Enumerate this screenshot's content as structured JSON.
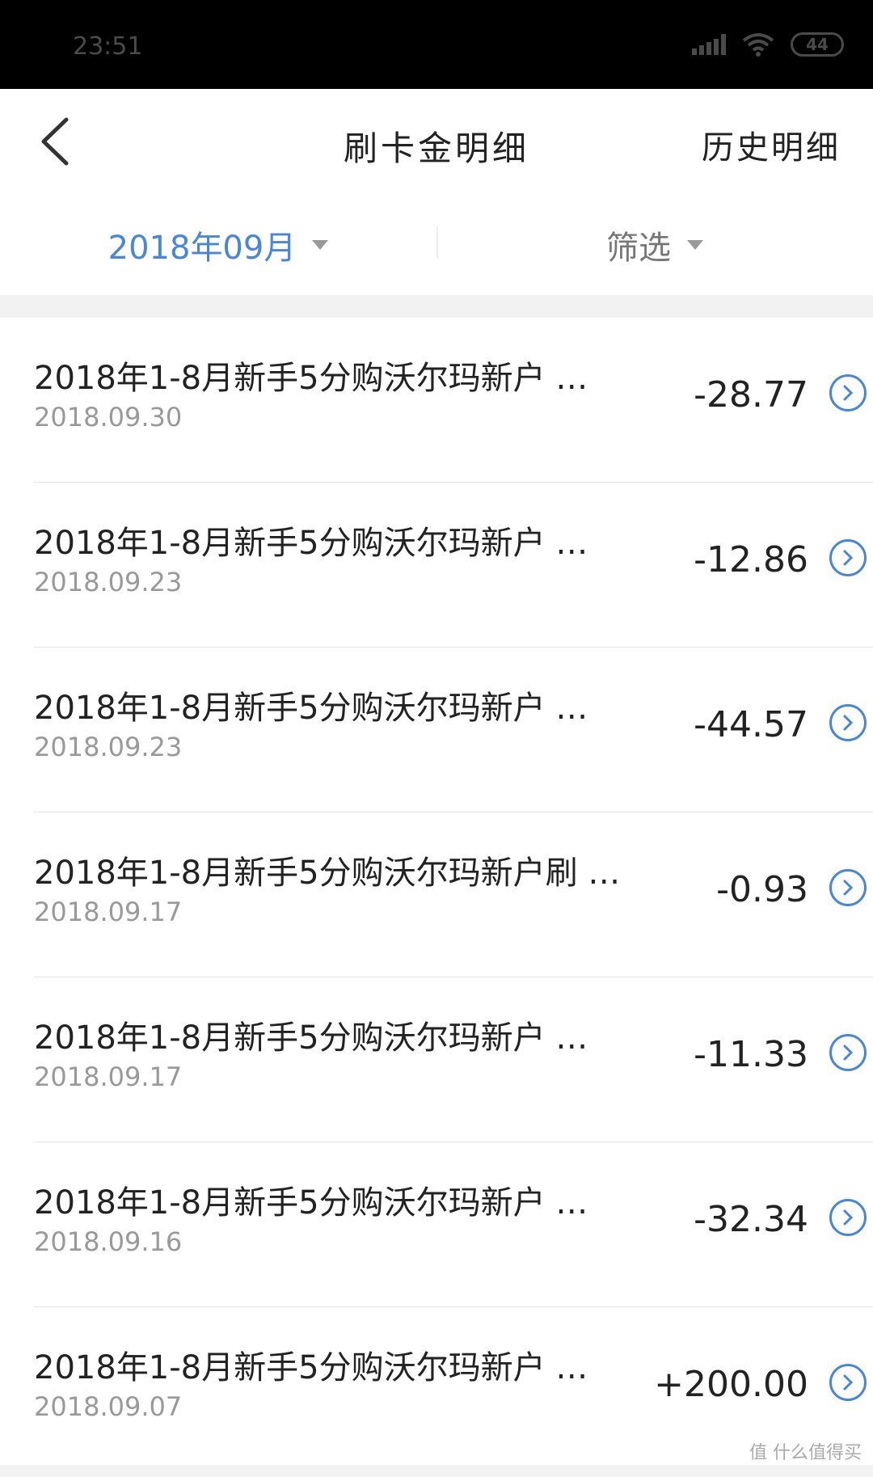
{
  "status_bar": {
    "time": "23:51",
    "battery": "44"
  },
  "nav": {
    "title": "刷卡金明细",
    "history": "历史明细"
  },
  "filter": {
    "month": "2018年09月",
    "filter_label": "筛选"
  },
  "items": [
    {
      "title": "2018年1-8月新手5分购沃尔玛新户 …",
      "date": "2018.09.30",
      "amount": "-28.77"
    },
    {
      "title": "2018年1-8月新手5分购沃尔玛新户 …",
      "date": "2018.09.23",
      "amount": "-12.86"
    },
    {
      "title": "2018年1-8月新手5分购沃尔玛新户 …",
      "date": "2018.09.23",
      "amount": "-44.57"
    },
    {
      "title": "2018年1-8月新手5分购沃尔玛新户刷 …",
      "date": "2018.09.17",
      "amount": "-0.93"
    },
    {
      "title": "2018年1-8月新手5分购沃尔玛新户 …",
      "date": "2018.09.17",
      "amount": "-11.33"
    },
    {
      "title": "2018年1-8月新手5分购沃尔玛新户 …",
      "date": "2018.09.16",
      "amount": "-32.34"
    },
    {
      "title": "2018年1-8月新手5分购沃尔玛新户 …",
      "date": "2018.09.07",
      "amount": "+200.00"
    }
  ],
  "watermark": "值 什么值得买",
  "colors": {
    "accent": "#4a86d8",
    "text": "#222222",
    "muted": "#999999"
  }
}
